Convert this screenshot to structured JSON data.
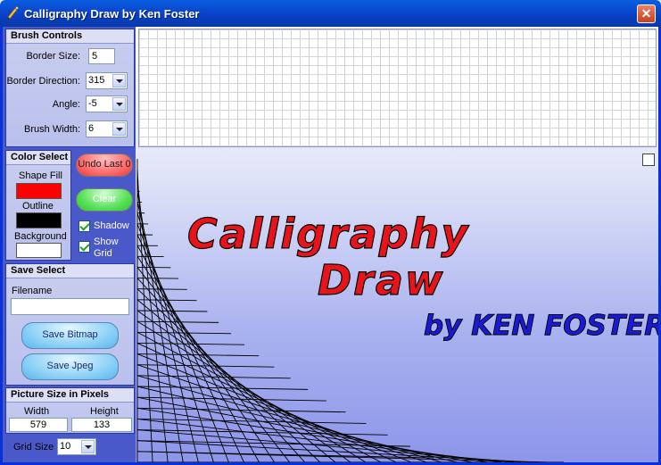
{
  "window": {
    "title": "Calligraphy Draw by Ken Foster",
    "close_glyph": "✕"
  },
  "brush_controls": {
    "header": "Brush Controls",
    "border_size_label": "Border Size:",
    "border_size_value": "5",
    "border_direction_label": "Border Direction:",
    "border_direction_value": "315",
    "angle_label": "Angle:",
    "angle_value": "-5",
    "brush_width_label": "Brush Width:",
    "brush_width_value": "6"
  },
  "color_select": {
    "header": "Color Select",
    "shape_fill_label": "Shape Fill",
    "shape_fill_color": "#ff0000",
    "outline_label": "Outline",
    "outline_color": "#000000",
    "background_label": "Background",
    "background_color": "#ffffff"
  },
  "actions": {
    "undo_label": "Undo Last 0",
    "clear_label": "Clear",
    "shadow_label": "Shadow",
    "shadow_checked": true,
    "show_grid_label": "Show Grid",
    "show_grid_checked": true
  },
  "save_select": {
    "header": "Save Select",
    "filename_label": "Filename",
    "filename_value": "",
    "save_bitmap_label": "Save Bitmap",
    "save_jpeg_label": "Save Jpeg"
  },
  "picture_size": {
    "header": "Picture Size in Pixels",
    "width_label": "Width",
    "width_value": "579",
    "height_label": "Height",
    "height_value": "133"
  },
  "grid_size": {
    "label": "Grid Size",
    "value": "10"
  },
  "canvas": {
    "line1": "Calligraphy",
    "line2": "Draw",
    "line3": "by KEN FOSTER",
    "fill_color": "#e8141c",
    "byline_color": "#1a1ad4",
    "outline_color": "#000000"
  }
}
